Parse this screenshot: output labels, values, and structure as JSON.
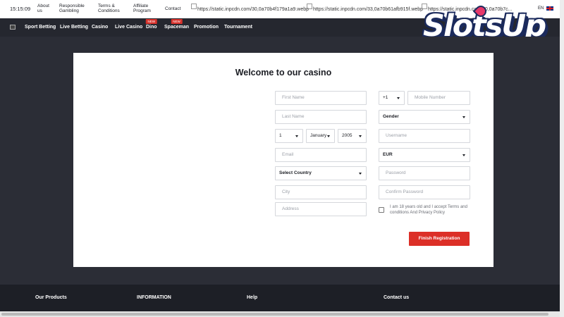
{
  "topbar": {
    "time": "15:15:09",
    "links": [
      {
        "l1": "About",
        "l2": "us"
      },
      {
        "l1": "Responsible",
        "l2": "Gambling"
      },
      {
        "l1": "Terms &",
        "l2": "Conditions"
      },
      {
        "l1": "Affiliate",
        "l2": "Program"
      },
      {
        "l1": "Contact",
        "l2": ""
      }
    ],
    "images": [
      "https://static.inpcdn.com/30,0a70b4f179a1a9.webp",
      "https://static.inpcdn.com/33,0a70b61afb915f.webp",
      "https://static.inpcdn.com/30,0a70b7c..."
    ],
    "lang": "EN"
  },
  "nav": {
    "items": [
      {
        "label": "Sport Betting",
        "badge": ""
      },
      {
        "label": "Live Betting",
        "badge": ""
      },
      {
        "label": "Casino",
        "badge": ""
      },
      {
        "label": "Live Casino",
        "badge": ""
      },
      {
        "label": "Dino",
        "badge": "NEW"
      },
      {
        "label": "Spaceman",
        "badge": "NEW"
      },
      {
        "label": "Promotion",
        "badge": ""
      },
      {
        "label": "Tournament",
        "badge": ""
      }
    ]
  },
  "watermark": {
    "text": "SlotsUp"
  },
  "form": {
    "title": "Welcome to our casino",
    "first_name_placeholder": "First Name",
    "last_name_placeholder": "Last Name",
    "birth_day": "1",
    "birth_month": "January",
    "birth_year": "2005",
    "email_placeholder": "Email",
    "country": "Select Country",
    "city_placeholder": "City",
    "address_placeholder": "Address",
    "phone_code": "+1",
    "mobile_placeholder": "Mobile Number",
    "gender": "Gender",
    "username_placeholder": "Username",
    "currency": "EUR",
    "password_placeholder": "Password",
    "confirm_password_placeholder": "Confirm Password",
    "terms_text": "I am 18 years old and I accept Terms and conditions And Privacy Policy",
    "submit_label": "Finish Registration"
  },
  "footer": {
    "columns": [
      "Our Products",
      "INFORMATION",
      "Help",
      "Contact us"
    ]
  },
  "colors": {
    "accent_red": "#dc2f27",
    "nav_bg": "#25272f",
    "page_bg": "#2b2d36"
  }
}
